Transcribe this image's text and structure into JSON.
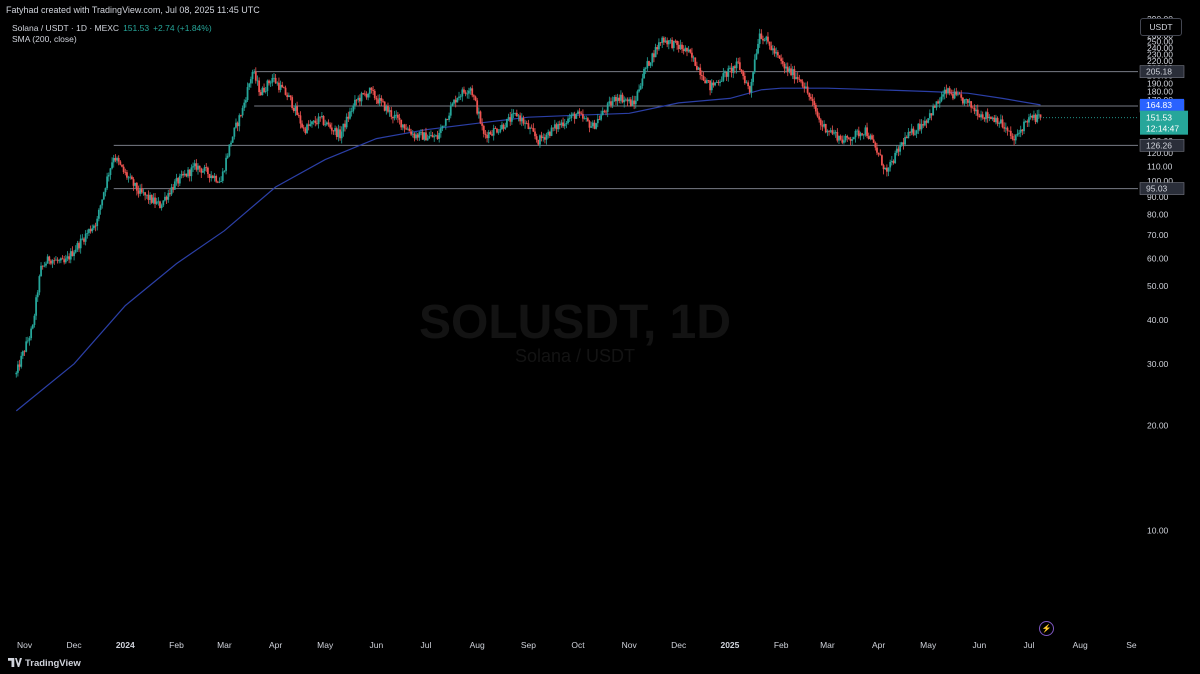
{
  "caption": "Fatyhad created with TradingView.com, Jul 08, 2025 11:45 UTC",
  "header": {
    "symbol_line": "Solana / USDT · 1D · MEXC",
    "price": "151.53",
    "change": "+2.74 (+1.84%)",
    "indicator": "SMA (200, close)"
  },
  "currency": "USDT",
  "watermark": {
    "main": "SOLUSDT, 1D",
    "sub": "Solana / USDT"
  },
  "branding": "TradingView",
  "lightning_glyph": "⚡",
  "colors": {
    "up": "#26a69a",
    "down": "#ef5350",
    "sma": "#2b3fa6",
    "level": "#787b86",
    "background": "#000000",
    "sma_badge": "#2962ff"
  },
  "chart_data": {
    "type": "candlestick",
    "y_ticks": [
      10,
      20,
      30,
      40,
      50,
      60,
      70,
      80,
      90,
      100,
      110,
      120,
      130,
      140,
      150,
      160,
      170,
      180,
      190,
      200,
      210,
      220,
      230,
      240,
      250,
      260,
      270,
      280,
      290
    ],
    "y_range": [
      5,
      292
    ],
    "x_ticks": [
      {
        "label": "Nov",
        "date": "2023-11-01"
      },
      {
        "label": "Dec",
        "date": "2023-12-01"
      },
      {
        "label": "2024",
        "date": "2024-01-01",
        "bold": true
      },
      {
        "label": "Feb",
        "date": "2024-02-01"
      },
      {
        "label": "Mar",
        "date": "2024-03-01"
      },
      {
        "label": "Apr",
        "date": "2024-04-01"
      },
      {
        "label": "May",
        "date": "2024-05-01"
      },
      {
        "label": "Jun",
        "date": "2024-06-01"
      },
      {
        "label": "Jul",
        "date": "2024-07-01"
      },
      {
        "label": "Aug",
        "date": "2024-08-01"
      },
      {
        "label": "Sep",
        "date": "2024-09-01"
      },
      {
        "label": "Oct",
        "date": "2024-10-01"
      },
      {
        "label": "Nov",
        "date": "2024-11-01"
      },
      {
        "label": "Dec",
        "date": "2024-12-01"
      },
      {
        "label": "2025",
        "date": "2025-01-01",
        "bold": true
      },
      {
        "label": "Feb",
        "date": "2025-02-01"
      },
      {
        "label": "Mar",
        "date": "2025-03-01"
      },
      {
        "label": "Apr",
        "date": "2025-04-01"
      },
      {
        "label": "May",
        "date": "2025-05-01"
      },
      {
        "label": "Jun",
        "date": "2025-06-01"
      },
      {
        "label": "Jul",
        "date": "2025-07-01"
      },
      {
        "label": "Aug",
        "date": "2025-08-01"
      },
      {
        "label": "Se",
        "date": "2025-09-01"
      }
    ],
    "horizontal_levels": [
      {
        "value": 205.18,
        "label": "205.18",
        "start_date": "2024-03-19"
      },
      {
        "value": 163.58,
        "label": "163.58",
        "start_date": "2024-03-19"
      },
      {
        "value": 126.26,
        "label": "126.26",
        "start_date": "2023-12-25"
      },
      {
        "value": 95.03,
        "label": "95.03",
        "start_date": "2023-12-25"
      }
    ],
    "price_badge": {
      "value": 151.53,
      "label": "151.53",
      "countdown": "12:14:47"
    },
    "sma_badge": {
      "value": 164.83,
      "label": "164.83"
    },
    "price_path": [
      [
        "2023-10-27",
        28
      ],
      [
        "2023-11-06",
        38
      ],
      [
        "2023-11-11",
        56
      ],
      [
        "2023-11-16",
        60
      ],
      [
        "2023-11-25",
        58
      ],
      [
        "2023-12-05",
        67
      ],
      [
        "2023-12-15",
        77
      ],
      [
        "2023-12-25",
        118
      ],
      [
        "2023-12-31",
        106
      ],
      [
        "2024-01-09",
        93
      ],
      [
        "2024-01-22",
        85
      ],
      [
        "2024-01-31",
        98
      ],
      [
        "2024-02-13",
        110
      ],
      [
        "2024-02-28",
        100
      ],
      [
        "2024-03-05",
        130
      ],
      [
        "2024-03-12",
        160
      ],
      [
        "2024-03-18",
        205
      ],
      [
        "2024-03-23",
        178
      ],
      [
        "2024-03-30",
        197
      ],
      [
        "2024-04-10",
        170
      ],
      [
        "2024-04-18",
        140
      ],
      [
        "2024-04-28",
        150
      ],
      [
        "2024-05-10",
        135
      ],
      [
        "2024-05-20",
        170
      ],
      [
        "2024-05-28",
        180
      ],
      [
        "2024-06-10",
        155
      ],
      [
        "2024-06-24",
        135
      ],
      [
        "2024-07-08",
        133
      ],
      [
        "2024-07-20",
        175
      ],
      [
        "2024-07-28",
        185
      ],
      [
        "2024-08-05",
        135
      ],
      [
        "2024-08-15",
        142
      ],
      [
        "2024-08-25",
        155
      ],
      [
        "2024-09-07",
        130
      ],
      [
        "2024-09-20",
        145
      ],
      [
        "2024-09-30",
        155
      ],
      [
        "2024-10-10",
        143
      ],
      [
        "2024-10-25",
        175
      ],
      [
        "2024-11-04",
        165
      ],
      [
        "2024-11-10",
        205
      ],
      [
        "2024-11-21",
        255
      ],
      [
        "2024-12-06",
        235
      ],
      [
        "2024-12-20",
        185
      ],
      [
        "2025-01-06",
        215
      ],
      [
        "2025-01-13",
        180
      ],
      [
        "2025-01-19",
        265
      ],
      [
        "2025-01-26",
        240
      ],
      [
        "2025-02-03",
        210
      ],
      [
        "2025-02-13",
        195
      ],
      [
        "2025-02-25",
        145
      ],
      [
        "2025-03-11",
        130
      ],
      [
        "2025-03-24",
        140
      ],
      [
        "2025-04-06",
        105
      ],
      [
        "2025-04-16",
        130
      ],
      [
        "2025-04-30",
        150
      ],
      [
        "2025-05-12",
        180
      ],
      [
        "2025-05-22",
        170
      ],
      [
        "2025-06-02",
        155
      ],
      [
        "2025-06-12",
        150
      ],
      [
        "2025-06-22",
        130
      ],
      [
        "2025-06-30",
        150
      ],
      [
        "2025-07-08",
        151.53
      ]
    ],
    "sma_path": [
      [
        "2023-10-27",
        22
      ],
      [
        "2023-12-01",
        30
      ],
      [
        "2024-01-01",
        44
      ],
      [
        "2024-02-01",
        58
      ],
      [
        "2024-03-01",
        72
      ],
      [
        "2024-04-01",
        96
      ],
      [
        "2024-05-01",
        115
      ],
      [
        "2024-06-01",
        132
      ],
      [
        "2024-07-01",
        140
      ],
      [
        "2024-08-01",
        146
      ],
      [
        "2024-09-01",
        152
      ],
      [
        "2024-10-01",
        154
      ],
      [
        "2024-11-01",
        156
      ],
      [
        "2024-12-01",
        167
      ],
      [
        "2025-01-01",
        172
      ],
      [
        "2025-01-20",
        182
      ],
      [
        "2025-02-01",
        184
      ],
      [
        "2025-03-01",
        184
      ],
      [
        "2025-04-01",
        182
      ],
      [
        "2025-05-01",
        180
      ],
      [
        "2025-05-25",
        178
      ],
      [
        "2025-06-15",
        172
      ],
      [
        "2025-07-08",
        164.83
      ]
    ]
  }
}
